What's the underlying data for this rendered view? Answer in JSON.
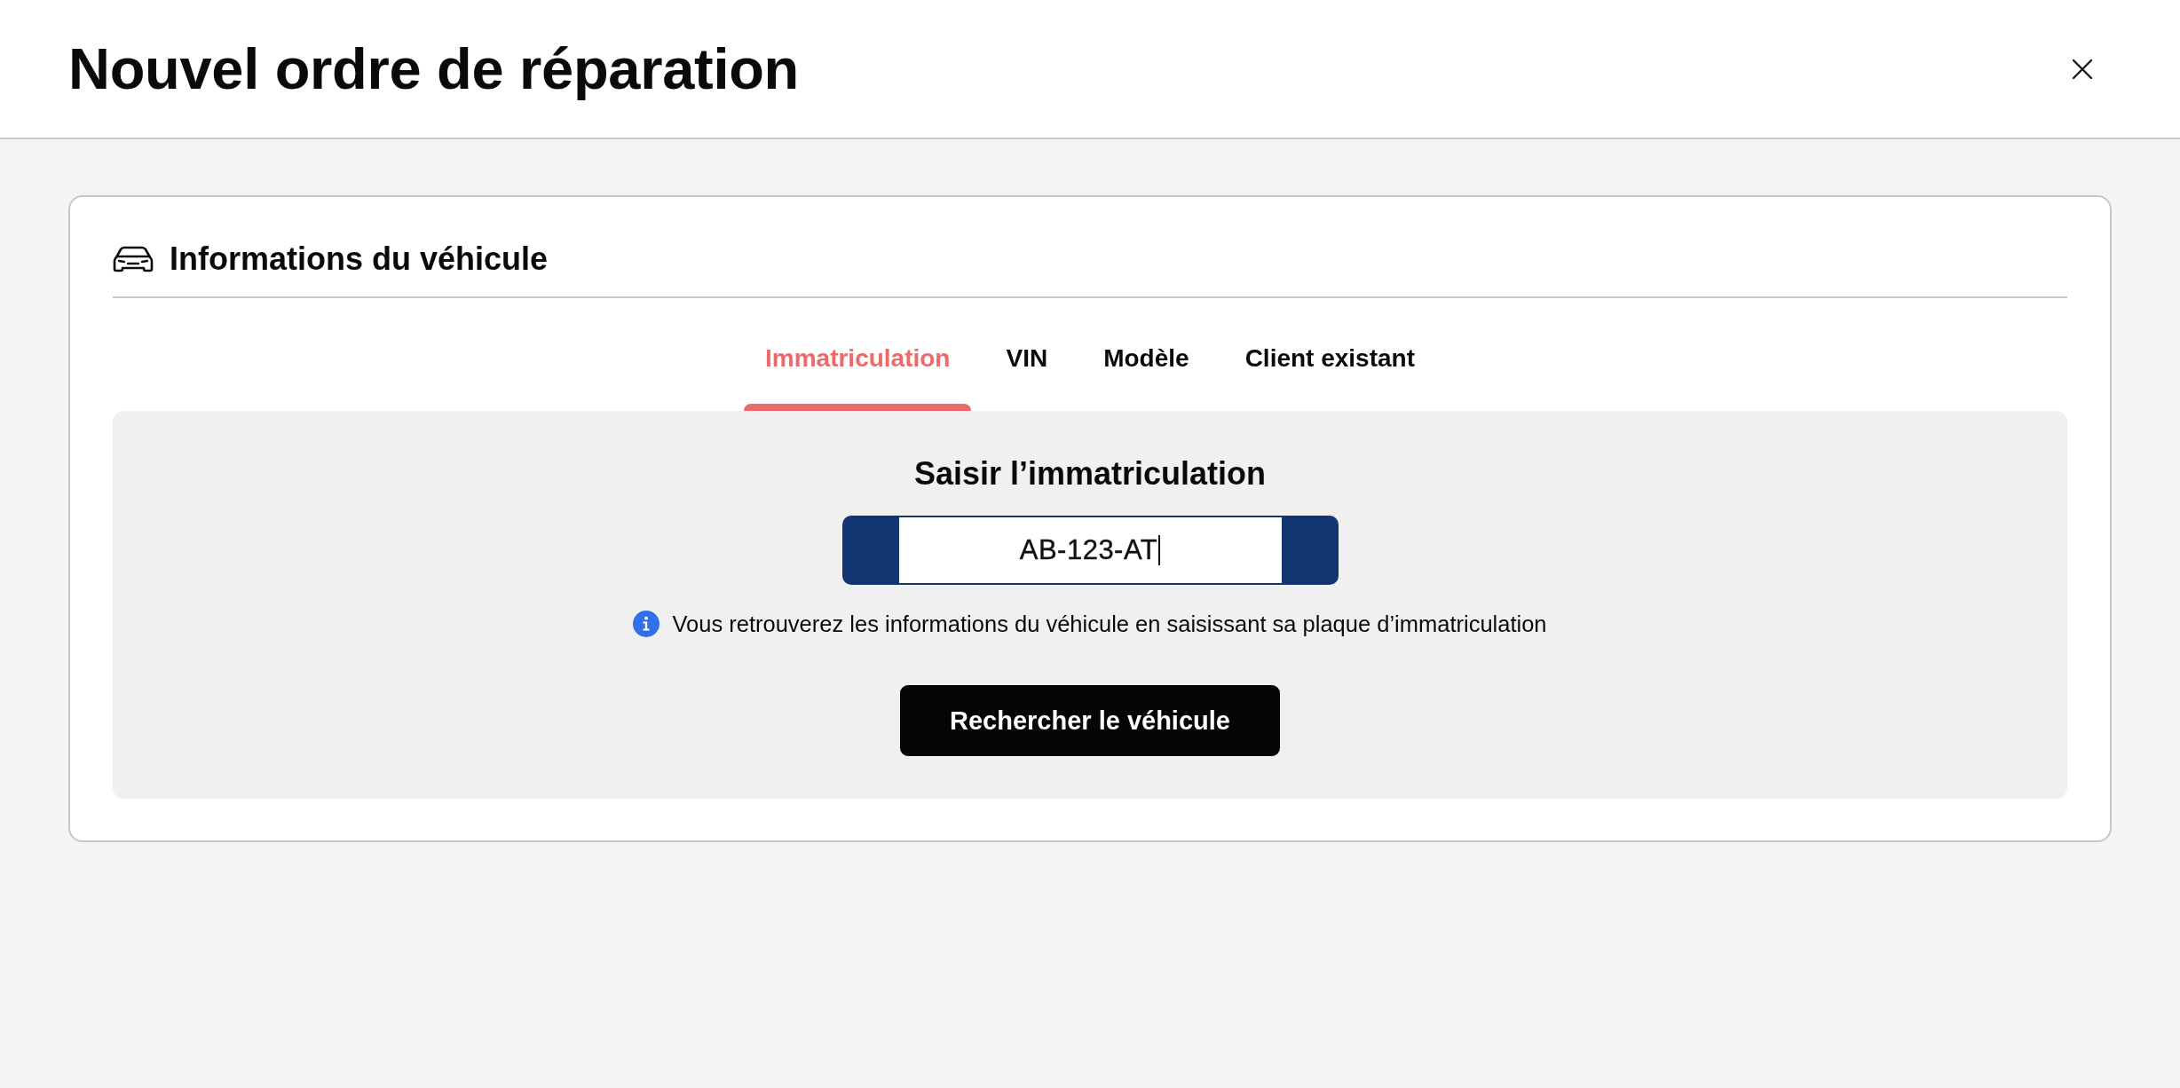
{
  "dialog": {
    "title": "Nouvel ordre de réparation"
  },
  "card": {
    "title": "Informations du véhicule"
  },
  "tabs": [
    {
      "label": "Immatriculation",
      "selected": true
    },
    {
      "label": "VIN",
      "selected": false
    },
    {
      "label": "Modèle",
      "selected": false
    },
    {
      "label": "Client existant",
      "selected": false
    }
  ],
  "plate_search": {
    "heading": "Saisir l’immatriculation",
    "plate": {
      "value": "AB-123-AT",
      "focused": true
    },
    "hint": "Vous retrouverez les informations du véhicule en saisissant sa plaque d’immatriculation",
    "button": "Rechercher le véhicule"
  }
}
